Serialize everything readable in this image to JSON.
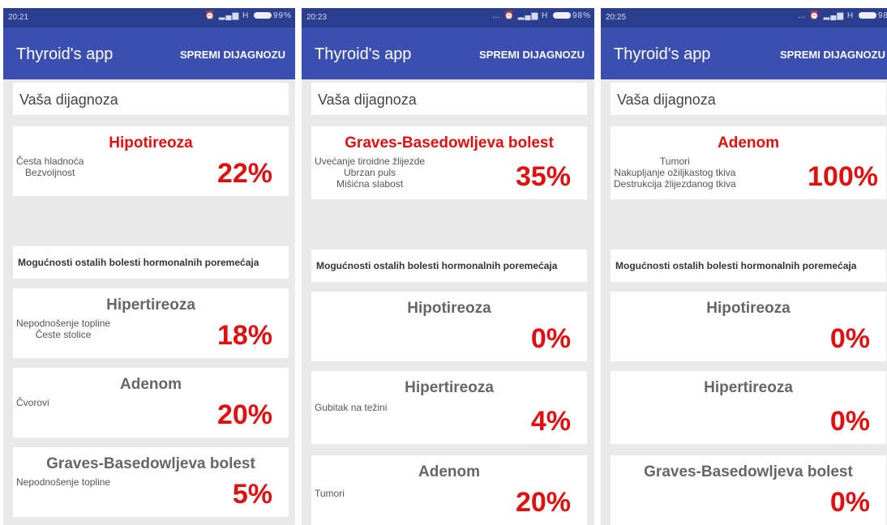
{
  "screens": [
    {
      "time": "20:21",
      "battery": "99%",
      "title": "Thyroid's app",
      "action": "SPREMI DIJAGNOZU",
      "heading": "Vaša dijagnoza",
      "main": {
        "name": "Hipotireoza",
        "symptoms": [
          "Česta hladnoća",
          "Bezvoljnost"
        ],
        "percent": "22%"
      },
      "others_label": "Mogućnosti ostalih bolesti hormonalnih poremećaja",
      "others": [
        {
          "name": "Hipertireoza",
          "symptoms": [
            "Nepodnošenje topline",
            "Česte stolice"
          ],
          "percent": "18%"
        },
        {
          "name": "Adenom",
          "symptoms": [
            "Čvorovi"
          ],
          "percent": "20%"
        },
        {
          "name": "Graves-Basedowljeva bolest",
          "symptoms": [
            "Nepodnošenje topline"
          ],
          "percent": "5%"
        }
      ]
    },
    {
      "time": "20:23",
      "battery": "98%",
      "title": "Thyroid's app",
      "action": "SPREMI DIJAGNOZU",
      "heading": "Vaša dijagnoza",
      "main": {
        "name": "Graves-Basedowljeva bolest",
        "symptoms": [
          "Uvećanje tiroidne žlijezde",
          "Ubrzan puls",
          "Mišićna slabost"
        ],
        "percent": "35%"
      },
      "others_label": "Mogućnosti ostalih bolesti hormonalnih poremećaja",
      "others": [
        {
          "name": "Hipotireoza",
          "symptoms": [],
          "percent": "0%"
        },
        {
          "name": "Hipertireoza",
          "symptoms": [
            "Gubitak na težini"
          ],
          "percent": "4%"
        },
        {
          "name": "Adenom",
          "symptoms": [
            "Tumori"
          ],
          "percent": "20%"
        }
      ]
    },
    {
      "time": "20:25",
      "battery": "98",
      "title": "Thyroid's app",
      "action": "SPREMI DIJAGNOZU",
      "heading": "Vaša dijagnoza",
      "main": {
        "name": "Adenom",
        "symptoms": [
          "Tumori",
          "Nakupljanje ožiljkastog tkiva",
          "Destrukcija žlijezdanog tkiva"
        ],
        "percent": "100%"
      },
      "others_label": "Mogućnosti ostalih bolesti hormonalnih poremećaja",
      "others": [
        {
          "name": "Hipotireoza",
          "symptoms": [],
          "percent": "0%"
        },
        {
          "name": "Hipertireoza",
          "symptoms": [],
          "percent": "0%"
        },
        {
          "name": "Graves-Basedowljeva bolest",
          "symptoms": [],
          "percent": "0%"
        }
      ]
    }
  ]
}
